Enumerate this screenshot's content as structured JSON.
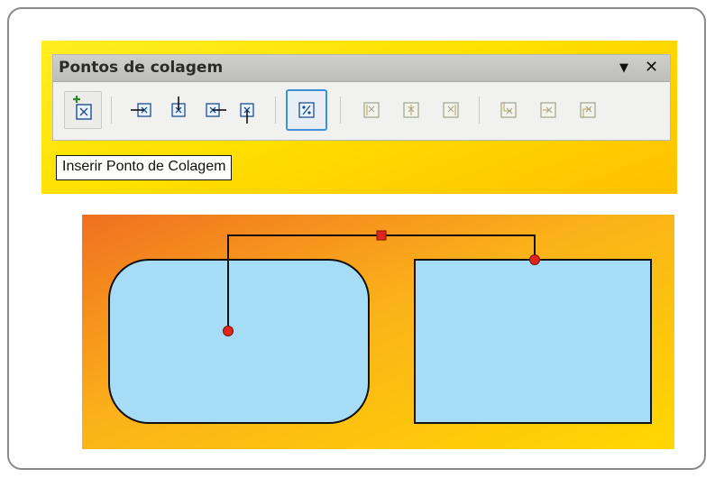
{
  "toolbar": {
    "title": "Pontos de colagem",
    "menu_arrow": "▼",
    "close": "✕",
    "buttons": [
      {
        "name": "insert-glue-point",
        "state": "hover"
      },
      {
        "name": "exit-direction-left",
        "state": "normal"
      },
      {
        "name": "exit-direction-top",
        "state": "normal"
      },
      {
        "name": "exit-direction-right",
        "state": "normal"
      },
      {
        "name": "exit-direction-bottom",
        "state": "normal"
      },
      {
        "name": "glue-point-relative",
        "state": "active"
      },
      {
        "name": "glue-point-horizontal-left",
        "state": "disabled"
      },
      {
        "name": "glue-point-horizontal-center",
        "state": "disabled"
      },
      {
        "name": "glue-point-horizontal-right",
        "state": "disabled"
      },
      {
        "name": "glue-point-vertical-top",
        "state": "disabled"
      },
      {
        "name": "glue-point-vertical-center",
        "state": "disabled"
      },
      {
        "name": "glue-point-vertical-bottom",
        "state": "disabled"
      }
    ]
  },
  "tooltip": {
    "text": "Inserir Ponto de Colagem"
  },
  "colors": {
    "shape_fill": "#a6dcf6",
    "glue_point": "#e0261b",
    "accent": "#3d8fd8",
    "canvas_orange": "#f07020",
    "canvas_yellow": "#ffd800"
  },
  "canvas": {
    "shapes": [
      "rounded-rectangle",
      "rectangle"
    ],
    "connector": "elbow-connector"
  }
}
